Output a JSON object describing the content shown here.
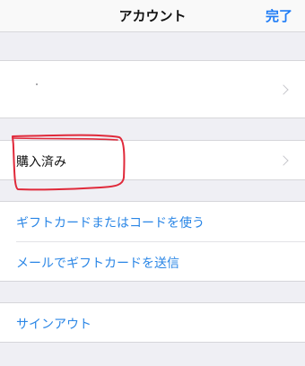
{
  "navbar": {
    "title": "アカウント",
    "done_label": "完了"
  },
  "account_group": {
    "row_label": ""
  },
  "purchases_group": {
    "purchased_label": "購入済み"
  },
  "gift_group": {
    "redeem_label": "ギフトカードまたはコードを使う",
    "send_label": "メールでギフトカードを送信"
  },
  "signout_group": {
    "signout_label": "サインアウト"
  },
  "colors": {
    "accent_blue": "#2a86e6",
    "annotation_red": "#e0293a",
    "background": "#efeff4"
  },
  "icons": {
    "disclosure": "chevron-right-icon"
  }
}
